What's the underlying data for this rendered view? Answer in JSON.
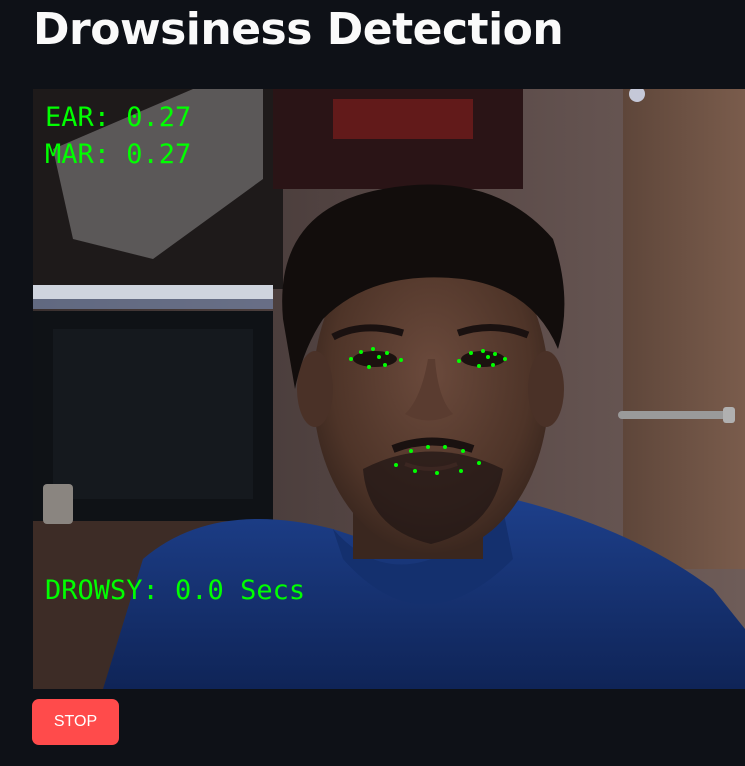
{
  "app": {
    "title": "Drowsiness Detection"
  },
  "video_overlay": {
    "ear_text": "EAR: 0.27",
    "mar_text": "MAR: 0.27",
    "drowsy_text": "DROWSY: 0.0 Secs",
    "text_color": "#00ff00"
  },
  "controls": {
    "stop_label": "STOP",
    "stop_color": "#ff4b4b"
  },
  "theme": {
    "background": "#0e1117",
    "title_color": "#fafafa"
  }
}
